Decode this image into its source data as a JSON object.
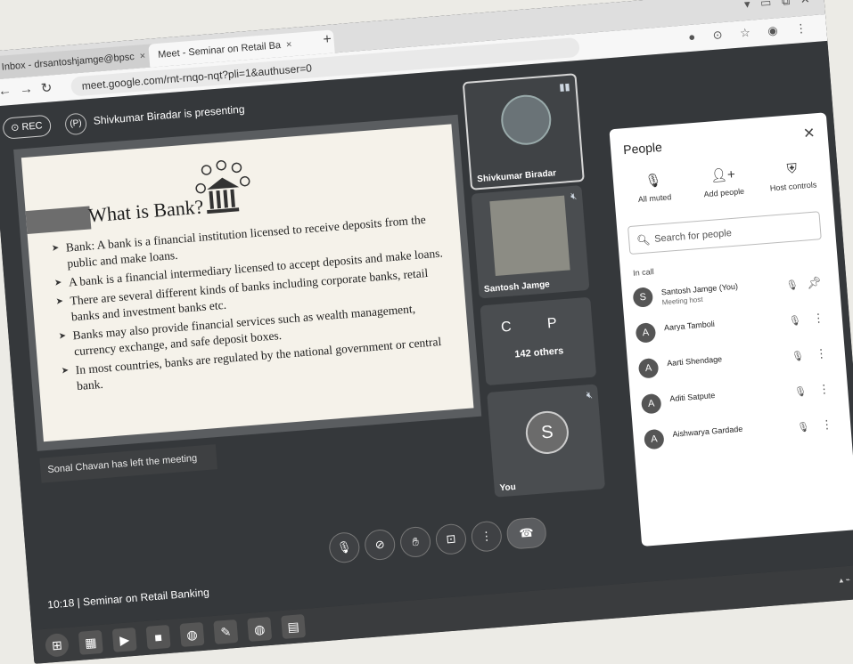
{
  "browser": {
    "tabs": [
      {
        "label": "Inbox - drsantoshjamge@bpsc",
        "active": false
      },
      {
        "label": "Meet - Seminar on Retail Ba",
        "active": true
      }
    ],
    "new_tab_symbol": "+",
    "url": "meet.google.com/rnt-rnqo-nqt?pli=1&authuser=0"
  },
  "meet": {
    "rec_label": "REC",
    "presenting_text": "Shivkumar Biradar is presenting",
    "presenter_initial": "(P)",
    "slide": {
      "title": "What is Bank?",
      "bullets": [
        "Bank: A bank is a financial institution licensed to receive deposits from the public and make loans.",
        "A bank is a financial intermediary licensed to accept deposits and make loans.",
        "There are several different kinds of banks including corporate banks, retail banks and investment banks etc.",
        "Banks may also provide financial services such as wealth management, currency exchange, and safe deposit boxes.",
        "In most countries, banks are regulated by the national government or central bank."
      ]
    },
    "toast": "Sonal Chavan has left the meeting",
    "tiles": [
      {
        "name": "Shivkumar Biradar"
      },
      {
        "name": "Santosh Jamge"
      },
      {
        "initials": "C  P",
        "others": "142 others"
      },
      {
        "name": "You",
        "initial": "S"
      }
    ],
    "meeting_info": "10:18  |  Seminar on Retail Banking"
  },
  "people_panel": {
    "title": "People",
    "actions": [
      {
        "label": "All muted",
        "icon": "mic-off-icon"
      },
      {
        "label": "Add people",
        "icon": "add-person-icon"
      },
      {
        "label": "Host controls",
        "icon": "shield-key-icon"
      }
    ],
    "search_placeholder": "Search for people",
    "section_label": "In call",
    "participants": [
      {
        "initial": "S",
        "name": "Santosh Jamge (You)",
        "subtitle": "Meeting host"
      },
      {
        "initial": "A",
        "name": "Aarya Tamboli",
        "subtitle": ""
      },
      {
        "initial": "A",
        "name": "Aarti Shendage",
        "subtitle": ""
      },
      {
        "initial": "A",
        "name": "Aditi Satpute",
        "subtitle": ""
      },
      {
        "initial": "A",
        "name": "Aishwarya Gardade",
        "subtitle": ""
      }
    ]
  }
}
